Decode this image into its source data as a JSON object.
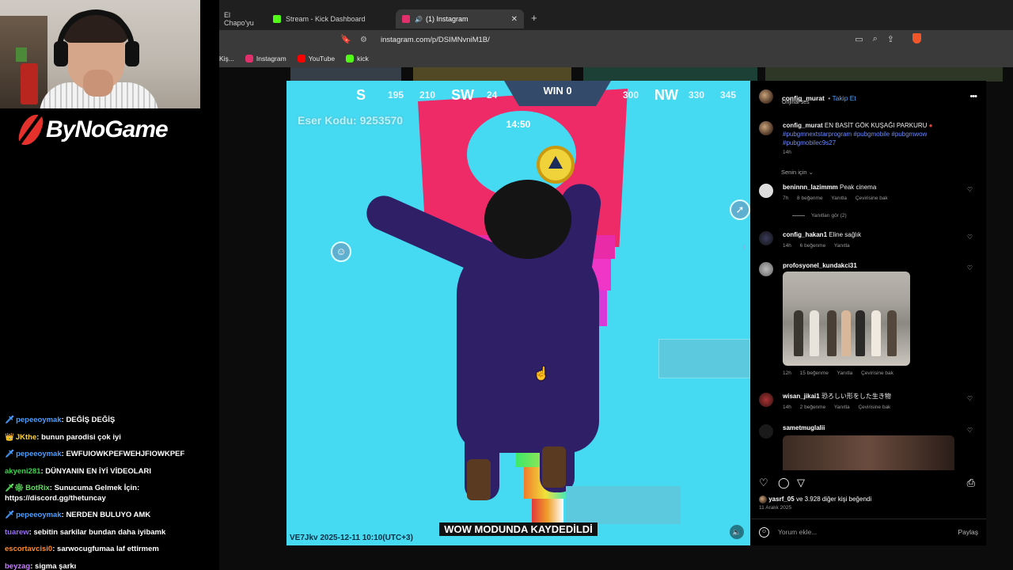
{
  "stream": {
    "brand": "ByNoGame",
    "chat": [
      {
        "user": "pepeeoymak",
        "color": "#4a9eff",
        "badge": "sword",
        "text": "DEĞİŞ DEĞİŞ"
      },
      {
        "user": "JKthe",
        "color": "#ffd23a",
        "badge": "crown",
        "text": "bunun parodisi çok iyi"
      },
      {
        "user": "pepeeoymak",
        "color": "#4a9eff",
        "badge": "sword",
        "text": "EWFUIOWKPEFWEHJFIOWKPEF"
      },
      {
        "user": "akyeni281",
        "color": "#3ccf4e",
        "badge": "",
        "text": "DÜNYANIN EN İYİ VİDEOLARI"
      },
      {
        "user": "BotRix",
        "color": "#5ee05e",
        "badge": "sword-gear",
        "text": "Sunucuma Gelmek İçin: https://discord.gg/thetuncay"
      },
      {
        "user": "pepeeoymak",
        "color": "#4a9eff",
        "badge": "sword",
        "text": "NERDEN BULUYO AMK"
      },
      {
        "user": "tuarew",
        "color": "#9b6bff",
        "badge": "",
        "text": "sebitin sarkilar bundan daha iyibamk"
      },
      {
        "user": "escortavcisi0",
        "color": "#ff8a2a",
        "badge": "",
        "text": "sarwocugfumaa laf ettirmem"
      },
      {
        "user": "beyzag",
        "color": "#c77dff",
        "badge": "",
        "text": "sigma şarkı"
      }
    ]
  },
  "browser": {
    "tabs": [
      {
        "label": "El Chapo'yu",
        "favicon_color": "#888888",
        "active": false
      },
      {
        "label": "Stream - Kick Dashboard",
        "favicon_color": "#53fc18",
        "active": false
      },
      {
        "label": "(1) Instagram",
        "favicon_color": "#e1306c",
        "active": true
      }
    ],
    "url": "instagram.com/p/DSIMNvniM1B/",
    "bookmarks": [
      {
        "label": "Kiş...",
        "color": "#666666"
      },
      {
        "label": "Instagram",
        "color": "#e1306c"
      },
      {
        "label": "YouTube",
        "color": "#ff0000"
      },
      {
        "label": "kick",
        "color": "#53fc18"
      }
    ],
    "icons": [
      "tune-icon",
      "bookmark-icon",
      "screen-icon",
      "zoom-icon",
      "share-icon",
      "brave-icon"
    ]
  },
  "video": {
    "hud_ticks": [
      "S",
      "195",
      "210",
      "SW",
      "24",
      "300",
      "NW",
      "330",
      "345"
    ],
    "win": "WIN 0",
    "timer": "14:50",
    "eser_kodu": "Eser Kodu: 9253570",
    "caption": "WOW MODUNDA KAYDEDİLDİ",
    "stamp": "VE7Jkv 2025-12-11 10:10(UTC+3)"
  },
  "post": {
    "author": "config_murat",
    "follow": "Takip Et",
    "audio": "Orijinal ses",
    "caption_text": "EN BASİT GÖK KUŞAĞI PARKURU",
    "hashtags": "#pubgmnextstarprogram #pubgmobile #pubgmwow #pubgmobilec9s27",
    "caption_time": "14h",
    "sort_label": "Senin için",
    "comments": [
      {
        "user": "beninnn_lazimmm",
        "text": "Peak cinema",
        "time": "7h",
        "likes": "8 beğenme",
        "reply": "Yanıtla",
        "translate": "Çevirisine bak",
        "replies": "Yanıtları gör (2)"
      },
      {
        "user": "config_hakan1",
        "text": "Eline sağlık",
        "time": "14h",
        "likes": "6 beğenme",
        "reply": "Yanıtla"
      },
      {
        "user": "profosyonel_kundakci31",
        "text": "",
        "time": "12h",
        "likes": "15 beğenme",
        "reply": "Yanıtla",
        "translate": "Çevirisine bak"
      },
      {
        "user": "wisan_jikai1",
        "text": "恐ろしい形をした生き物",
        "time": "14h",
        "likes": "2 beğenme",
        "reply": "Yanıtla",
        "translate": "Çevirisine bak"
      },
      {
        "user": "sametmuglalii",
        "text": ""
      }
    ],
    "liked_by_user": "yasrf_05",
    "liked_by_rest": "ve 3.928 diğer kişi beğendi",
    "date": "11 Aralık 2025",
    "comment_placeholder": "Yorum ekle...",
    "post_button": "Paylaş"
  }
}
